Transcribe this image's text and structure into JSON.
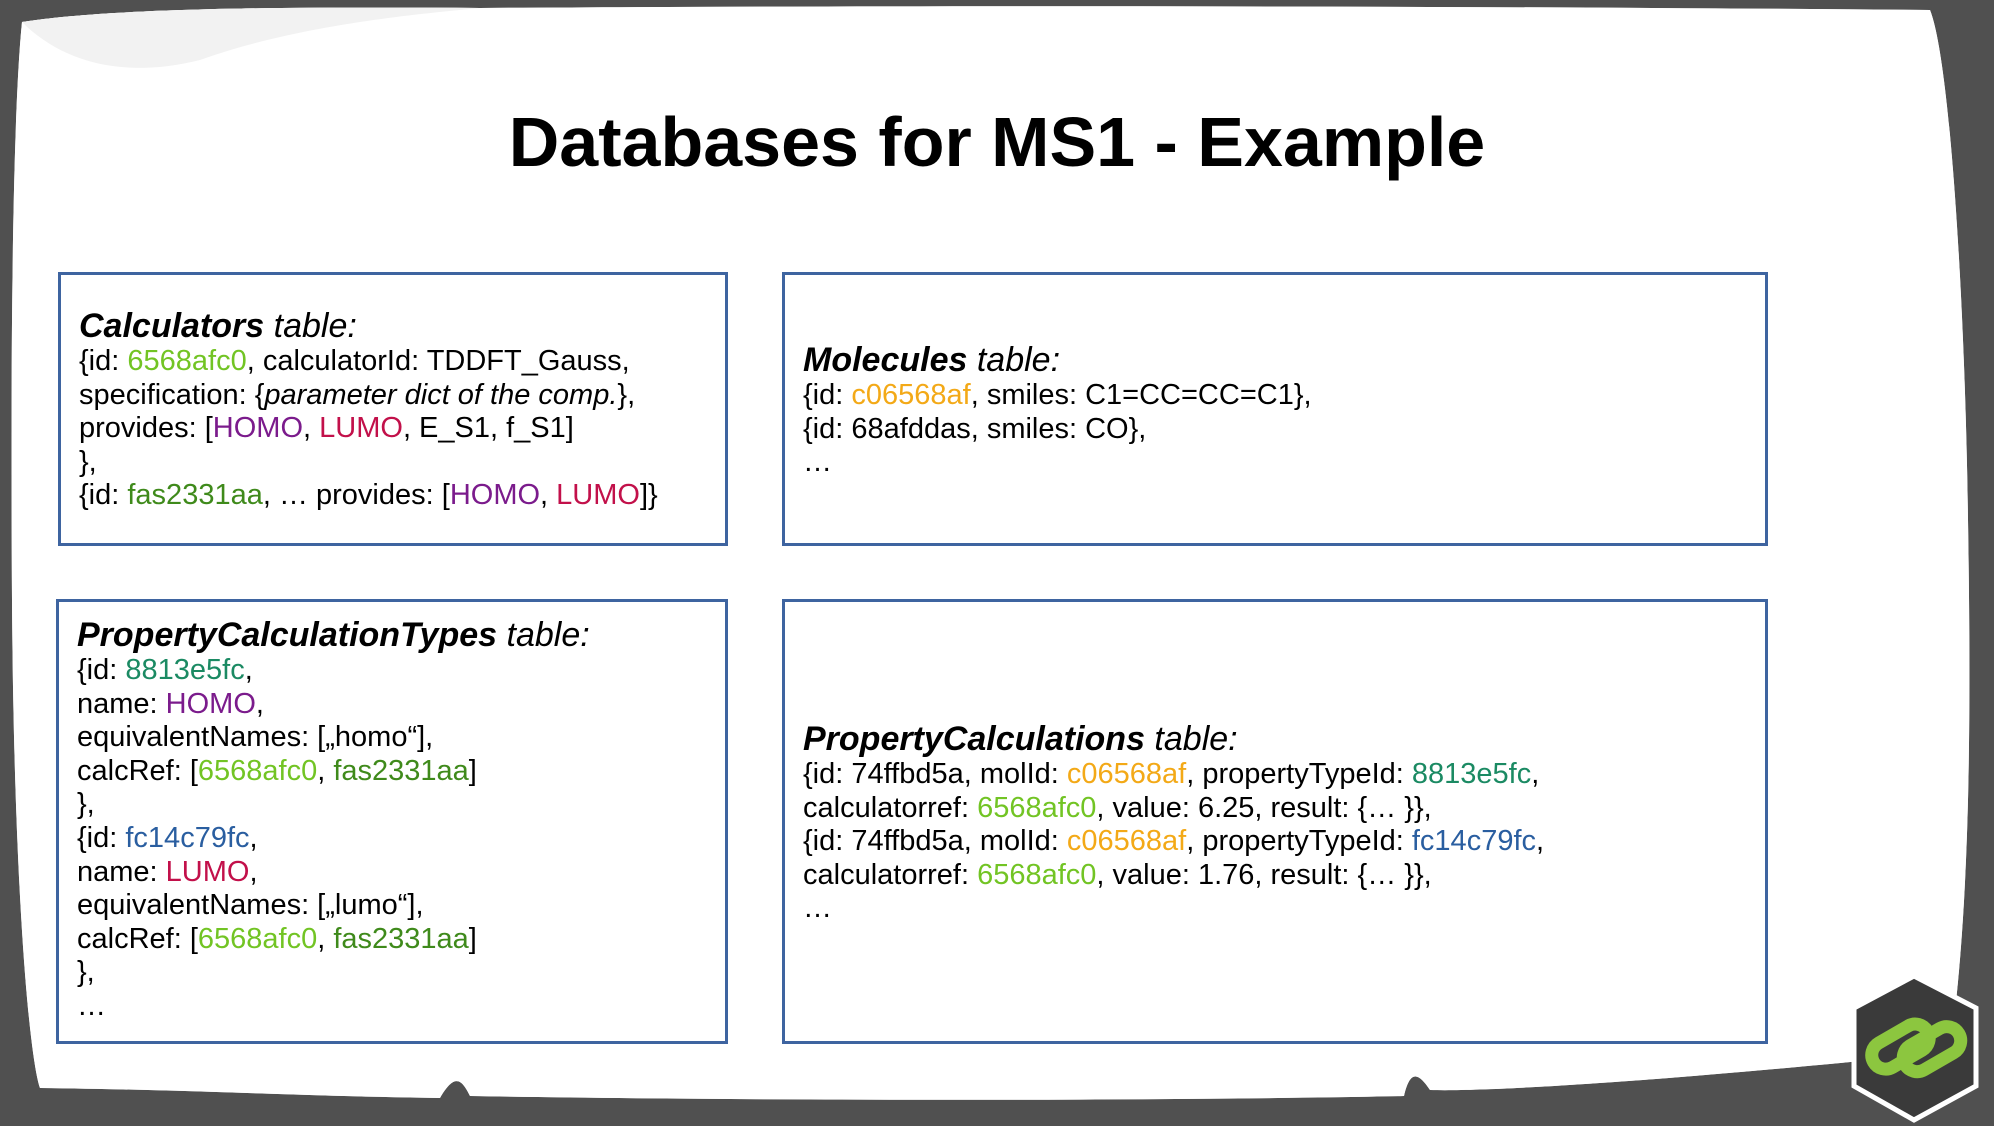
{
  "slide": {
    "title": "Databases for MS1 - Example"
  },
  "colors": {
    "calc_id": "#72c424",
    "calc_id_alt": "#3f8a1b",
    "homo": "#7b1b8c",
    "lumo": "#c2104a",
    "molecule_id": "#f3a917",
    "prop_type_homo": "#1b8a63",
    "prop_type_lumo": "#2a5ea0",
    "box_border": "#3e64a0"
  },
  "logo": {
    "icon": "hexagon-chain-link-icon"
  },
  "calculators": {
    "title_bold": "Calculators",
    "title_rest": " table:",
    "lines": [
      [
        {
          "t": "{id: "
        },
        {
          "t": "6568afc0",
          "c": "calc_id"
        },
        {
          "t": ", calculatorId: TDDFT_Gauss,"
        }
      ],
      [
        {
          "t": "specification: {"
        },
        {
          "t": "parameter dict of the comp.",
          "i": true
        },
        {
          "t": "},"
        }
      ],
      [
        {
          "t": "provides: ["
        },
        {
          "t": "HOMO",
          "c": "homo"
        },
        {
          "t": ", "
        },
        {
          "t": "LUMO",
          "c": "lumo"
        },
        {
          "t": ", E_S1, f_S1]"
        }
      ],
      [
        {
          "t": "},"
        }
      ],
      [
        {
          "t": "{id: "
        },
        {
          "t": "fas2331aa",
          "c": "calc_id_alt"
        },
        {
          "t": ", … provides: ["
        },
        {
          "t": "HOMO",
          "c": "homo"
        },
        {
          "t": ", "
        },
        {
          "t": "LUMO",
          "c": "lumo"
        },
        {
          "t": "]}"
        }
      ]
    ]
  },
  "molecules": {
    "title_bold": "Molecules",
    "title_rest": " table:",
    "lines": [
      [
        {
          "t": "{id: "
        },
        {
          "t": "c06568af",
          "c": "molecule_id"
        },
        {
          "t": ", smiles: C1=CC=CC=C1},"
        }
      ],
      [
        {
          "t": "{id: 68afddas, smiles: CO},"
        }
      ],
      [
        {
          "t": "…"
        }
      ]
    ]
  },
  "property_calculation_types": {
    "title_bold": "PropertyCalculationTypes",
    "title_rest": " table:",
    "lines": [
      [
        {
          "t": "{id: "
        },
        {
          "t": "8813e5fc",
          "c": "prop_type_homo"
        },
        {
          "t": ","
        }
      ],
      [
        {
          "t": "name: "
        },
        {
          "t": "HOMO",
          "c": "homo"
        },
        {
          "t": ","
        }
      ],
      [
        {
          "t": "equivalentNames: [„homo“],"
        }
      ],
      [
        {
          "t": "calcRef: ["
        },
        {
          "t": "6568afc0",
          "c": "calc_id"
        },
        {
          "t": ", "
        },
        {
          "t": "fas2331aa",
          "c": "calc_id_alt"
        },
        {
          "t": "]"
        }
      ],
      [
        {
          "t": "},"
        }
      ],
      [
        {
          "t": "{id: "
        },
        {
          "t": "fc14c79fc",
          "c": "prop_type_lumo"
        },
        {
          "t": ","
        }
      ],
      [
        {
          "t": "name: "
        },
        {
          "t": "LUMO",
          "c": "lumo"
        },
        {
          "t": ","
        }
      ],
      [
        {
          "t": "equivalentNames: [„lumo“],"
        }
      ],
      [
        {
          "t": "calcRef: ["
        },
        {
          "t": "6568afc0",
          "c": "calc_id"
        },
        {
          "t": ", "
        },
        {
          "t": "fas2331aa",
          "c": "calc_id_alt"
        },
        {
          "t": "]"
        }
      ],
      [
        {
          "t": "},"
        }
      ],
      [
        {
          "t": "…"
        }
      ]
    ]
  },
  "property_calculations": {
    "title_bold": "PropertyCalculations",
    "title_rest": " table:",
    "lines": [
      [
        {
          "t": "{id: 74ffbd5a, molId: "
        },
        {
          "t": "c06568af",
          "c": "molecule_id"
        },
        {
          "t": ", propertyTypeId: "
        },
        {
          "t": "8813e5fc",
          "c": "prop_type_homo"
        },
        {
          "t": ","
        }
      ],
      [
        {
          "t": "calculatorref: "
        },
        {
          "t": "6568afc0",
          "c": "calc_id"
        },
        {
          "t": ", value: 6.25, result: {… }},"
        }
      ],
      [
        {
          "t": "{id: 74ffbd5a, molId: "
        },
        {
          "t": "c06568af",
          "c": "molecule_id"
        },
        {
          "t": ", propertyTypeId: "
        },
        {
          "t": "fc14c79fc",
          "c": "prop_type_lumo"
        },
        {
          "t": ","
        }
      ],
      [
        {
          "t": "calculatorref: "
        },
        {
          "t": "6568afc0",
          "c": "calc_id"
        },
        {
          "t": ", value: 1.76, result: {… }},"
        }
      ],
      [
        {
          "t": "…"
        }
      ]
    ]
  }
}
